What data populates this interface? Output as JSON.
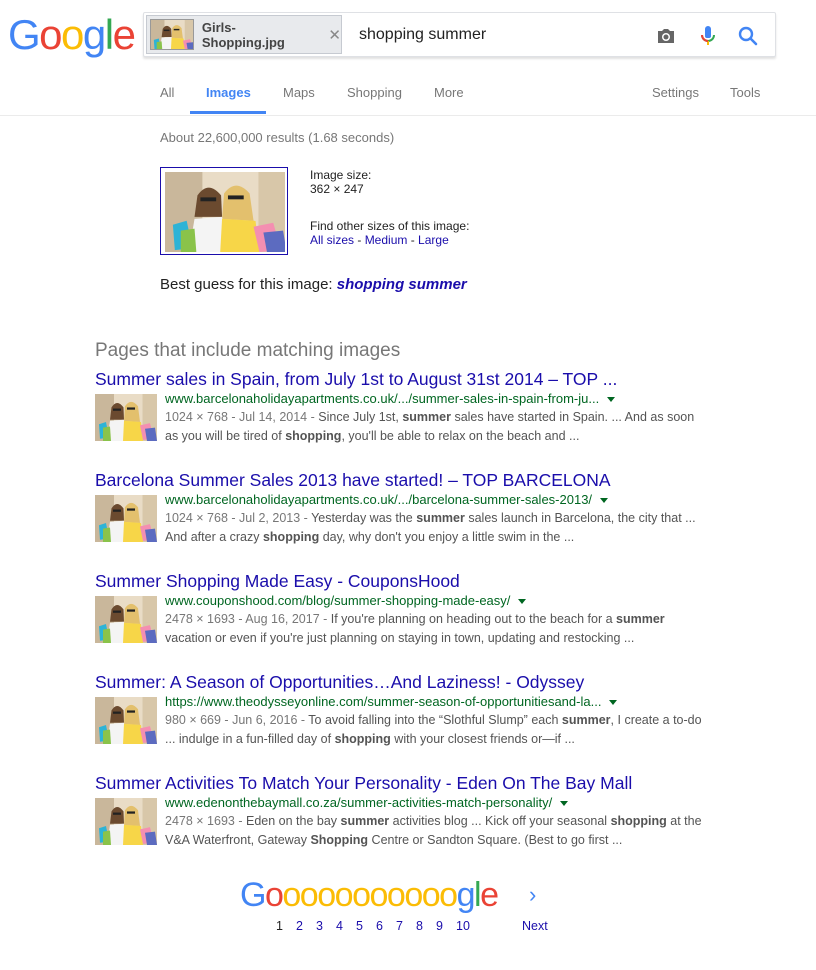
{
  "colors": {
    "link": "#1a0dab",
    "url": "#006621",
    "accent": "#4285f4"
  },
  "search": {
    "image_chip": {
      "filename": "Girls-Shopping.jpg",
      "remove_icon": "close-icon"
    },
    "query": "shopping summer",
    "icons": [
      "camera-icon",
      "microphone-icon",
      "search-icon"
    ]
  },
  "tabs": {
    "left": [
      "All",
      "Images",
      "Maps",
      "Shopping",
      "More"
    ],
    "right": [
      "Settings",
      "Tools"
    ],
    "active": "Images"
  },
  "stats": "About 22,600,000 results (1.68 seconds)",
  "image_info": {
    "size_label": "Image size:",
    "size_value": "362 × 247",
    "other_sizes_label": "Find other sizes of this image:",
    "links": [
      "All sizes",
      "Medium",
      "Large"
    ],
    "sep": " - "
  },
  "best_guess": {
    "label": "Best guess for this image: ",
    "value": "shopping summer"
  },
  "pages_heading": "Pages that include matching images",
  "results": [
    {
      "title": "Summer sales in Spain, from July 1st to August 31st 2014 – TOP ...",
      "url": "www.barcelonaholidayapartments.co.uk/.../summer-sales-in-spain-from-ju...",
      "meta": "1024 × 768 - Jul 14, 2014 - ",
      "snippet": "Since July 1st, <b>summer</b> sales have started in Spain. ... And as soon as you will be tired of <b>shopping</b>, you'll be able to relax on the beach and ..."
    },
    {
      "title": "Barcelona Summer Sales 2013 have started! – TOP BARCELONA",
      "url": "www.barcelonaholidayapartments.co.uk/.../barcelona-summer-sales-2013/",
      "meta": "1024 × 768 - Jul 2, 2013 - ",
      "snippet": "Yesterday was the <b>summer</b> sales launch in Barcelona, the city that ... And after a crazy <b>shopping</b> day, why don't you enjoy a little swim in the ..."
    },
    {
      "title": "Summer Shopping Made Easy - CouponsHood",
      "url": "www.couponshood.com/blog/summer-shopping-made-easy/",
      "meta": "2478 × 1693 - Aug 16, 2017 - ",
      "snippet": "If you're planning on heading out to the beach for a <b>summer</b> vacation or even if you're just planning on staying in town, updating and restocking ..."
    },
    {
      "title": "Summer: A Season of Opportunities…And Laziness! - Odyssey",
      "url": "https://www.theodysseyonline.com/summer-season-of-opportunitiesand-la...",
      "meta": "980 × 669 - Jun 6, 2016 - ",
      "snippet": "To avoid falling into the “Slothful Slump” each <b>summer</b>, I create a to-do ... indulge in a fun-filled day of <b>shopping</b> with your closest friends or—if ..."
    },
    {
      "title": "Summer Activities To Match Your Personality - Eden On The Bay Mall",
      "url": "www.edenonthebaymall.co.za/summer-activities-match-personality/",
      "meta": "2478 × 1693 - ",
      "snippet": "Eden on the bay <b>summer</b> activities blog ... Kick off your seasonal <b>shopping</b> at the V&amp;A Waterfront, Gateway <b>Shopping</b> Centre or Sandton Square. (Best to go first ..."
    }
  ],
  "pagination": {
    "logo_letters": [
      "G",
      "o",
      "o",
      "o",
      "o",
      "o",
      "o",
      "o",
      "o",
      "o",
      "o",
      "o",
      "g",
      "l",
      "e"
    ],
    "pages": [
      "1",
      "2",
      "3",
      "4",
      "5",
      "6",
      "7",
      "8",
      "9",
      "10"
    ],
    "current": "1",
    "next_label": "Next"
  }
}
